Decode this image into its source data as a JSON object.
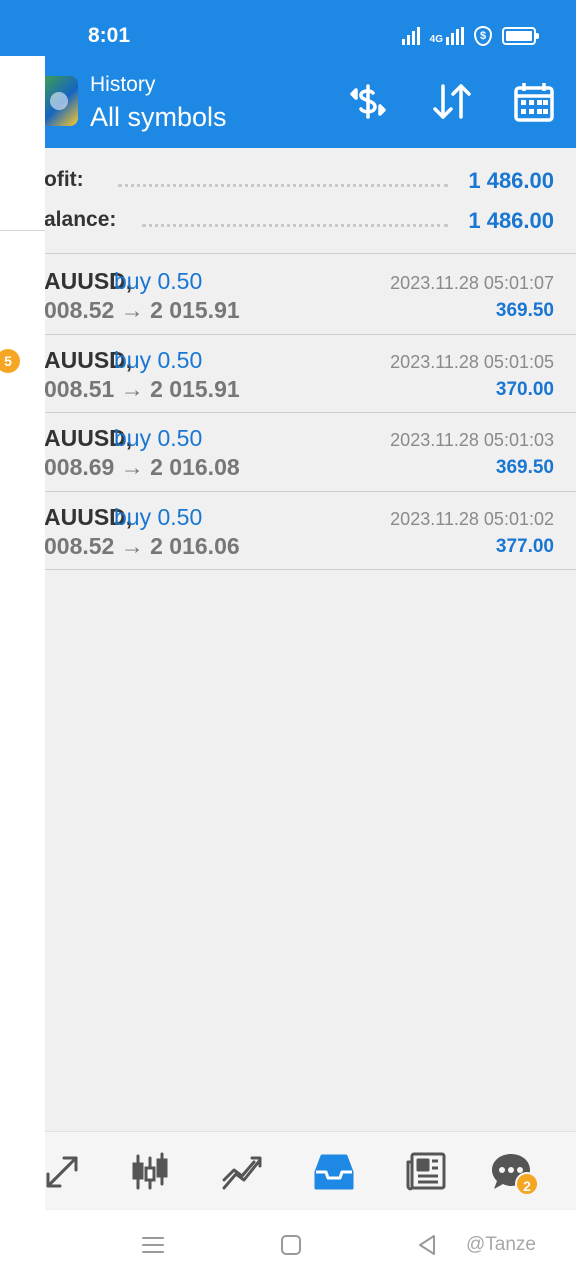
{
  "status_bar": {
    "time": "8:01",
    "network": "4G",
    "icons": [
      "signal-icon",
      "signal-4g-icon",
      "shield-dollar-icon",
      "battery-icon"
    ]
  },
  "header": {
    "subtitle": "History",
    "title": "All symbols",
    "actions": [
      "dollar-swap-icon",
      "sort-icon",
      "calendar-icon"
    ]
  },
  "summary": {
    "profit_label": "ofit:",
    "profit_value": "1 486.00",
    "balance_label": "alance:",
    "balance_value": "1 486.00"
  },
  "deals": [
    {
      "symbol": "AUUSD,",
      "action": "buy 0.50",
      "prices": "008.52 → 2 015.91",
      "datetime": "2023.11.28 05:01:07",
      "profit": "369.50"
    },
    {
      "symbol": "AUUSD,",
      "action": "buy 0.50",
      "prices": "008.51 → 2 015.91",
      "datetime": "2023.11.28 05:01:05",
      "profit": "370.00"
    },
    {
      "symbol": "AUUSD,",
      "action": "buy 0.50",
      "prices": "008.69 → 2 016.08",
      "datetime": "2023.11.28 05:01:03",
      "profit": "369.50"
    },
    {
      "symbol": "AUUSD,",
      "action": "buy 0.50",
      "prices": "008.52 → 2 016.06",
      "datetime": "2023.11.28 05:01:02",
      "profit": "377.00"
    }
  ],
  "drawer_badge": "5",
  "tabbar": {
    "tabs": [
      "trade-icon",
      "quotes-icon",
      "chart-icon",
      "history-icon",
      "news-icon",
      "chat-icon"
    ],
    "active": "history-icon",
    "chat_badge": "2"
  },
  "watermark": "@Tanze",
  "colors": {
    "accent": "#1e88e5",
    "value_blue": "#1976d2",
    "badge": "#f5a623"
  }
}
